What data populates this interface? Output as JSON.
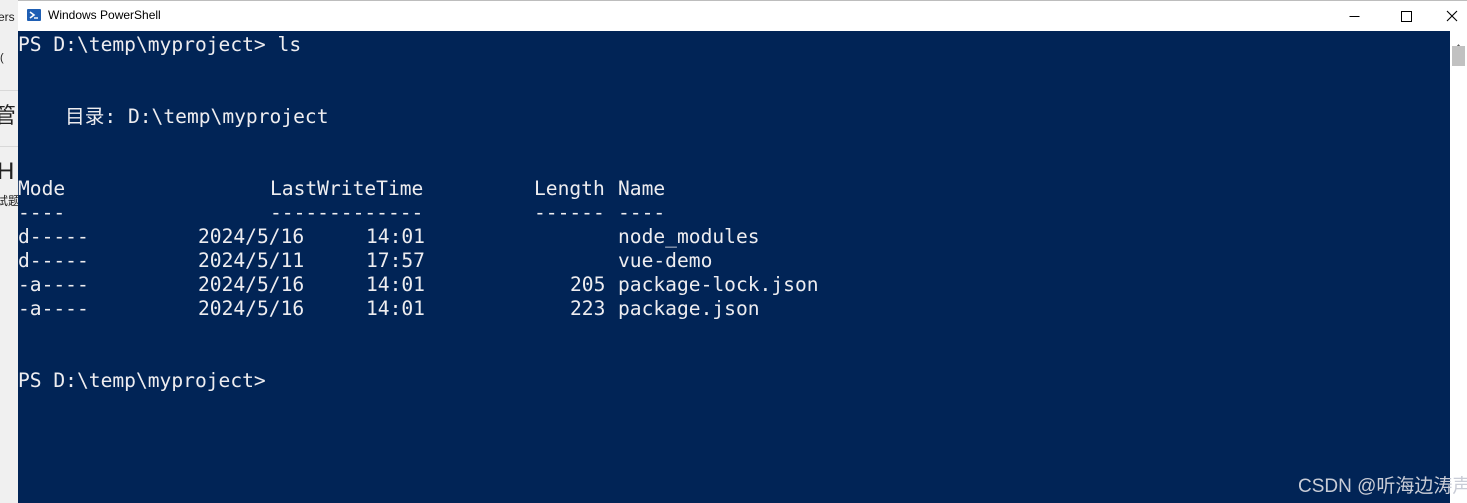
{
  "background_window": {
    "fragments": [
      "ers",
      "(",
      "管",
      "H",
      "试题"
    ]
  },
  "window": {
    "title": "Windows PowerShell",
    "icon": "powershell-icon",
    "controls": {
      "minimize": "minimize-icon",
      "maximize": "maximize-icon",
      "close": "close-icon"
    }
  },
  "colors": {
    "console_background": "#012456",
    "console_text": "#EEEDF0",
    "titlebar": "#FFFFFF"
  },
  "console": {
    "command_line": "PS D:\\temp\\myproject> ls",
    "directory_line": "    目录: D:\\temp\\myproject",
    "header": {
      "mode": "Mode",
      "last_write_time": "LastWriteTime",
      "length": "Length",
      "name": "Name"
    },
    "header_underline": {
      "mode": "----",
      "last_write_time": "-------------",
      "length": "------",
      "name": "----"
    },
    "rows": [
      {
        "mode": "d-----",
        "date": "2024/5/16",
        "time": "14:01",
        "length": "",
        "name": "node_modules"
      },
      {
        "mode": "d-----",
        "date": "2024/5/11",
        "time": "17:57",
        "length": "",
        "name": "vue-demo"
      },
      {
        "mode": "-a----",
        "date": "2024/5/16",
        "time": "14:01",
        "length": "205",
        "name": "package-lock.json"
      },
      {
        "mode": "-a----",
        "date": "2024/5/16",
        "time": "14:01",
        "length": "223",
        "name": "package.json"
      }
    ],
    "prompt_line": "PS D:\\temp\\myproject>"
  },
  "watermark": "CSDN @听海边涛声"
}
